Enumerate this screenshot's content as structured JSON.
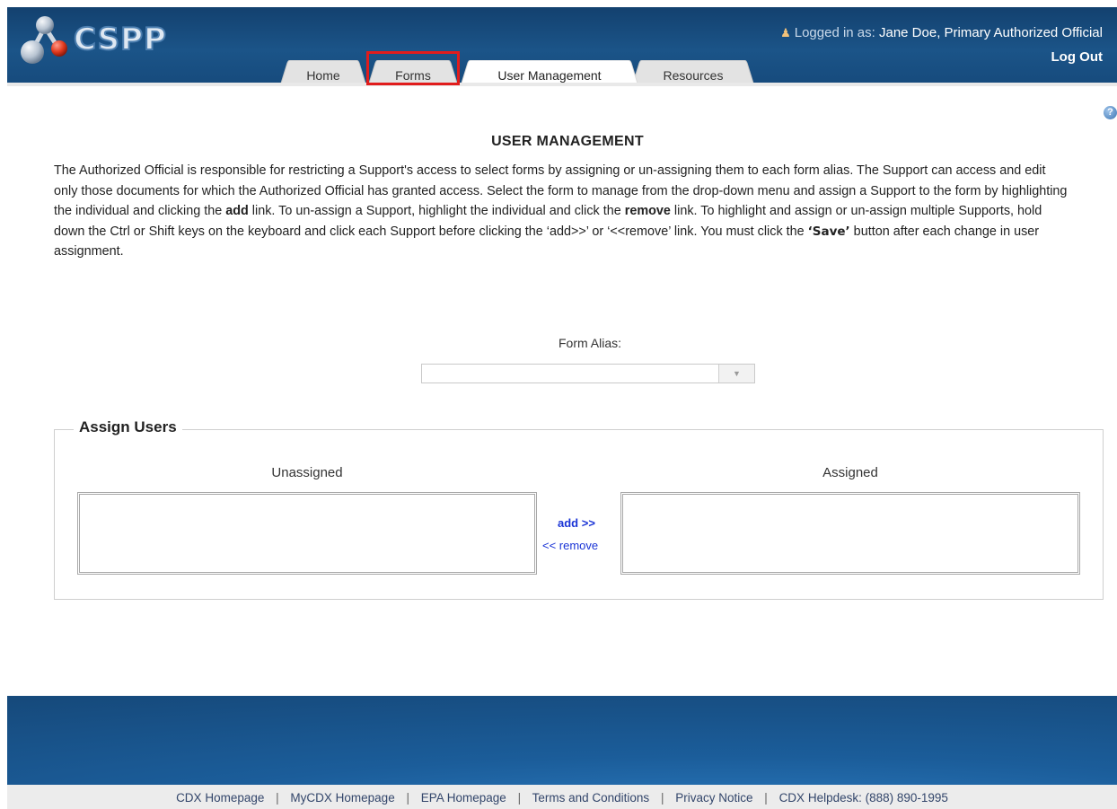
{
  "header": {
    "logo_text": "CSPP",
    "logged_in_prefix": "Logged in as:",
    "user_name": "Jane Doe, Primary Authorized Official",
    "logout_label": "Log Out"
  },
  "tabs": [
    {
      "label": "Home",
      "active": false
    },
    {
      "label": "Forms",
      "active": false,
      "highlighted": true
    },
    {
      "label": "User Management",
      "active": true
    },
    {
      "label": "Resources",
      "active": false
    }
  ],
  "page": {
    "title": "USER MANAGEMENT",
    "description": {
      "part1": "The Authorized Official is responsible for restricting a Support's access to select forms by assigning or un-assigning them to each form alias. The Support can access and edit only those documents for which the Authorized Official has granted access. Select the form to manage from the drop-down menu and assign a Support to the form by highlighting the individual and clicking the ",
      "add_word": "add",
      "part2": " link. To un-assign a Support, highlight the individual and click the ",
      "remove_word": "remove",
      "part3": " link. To highlight and assign or un-assign multiple Supports, hold down the Ctrl or Shift keys on the keyboard and click each Support before clicking the ‘add>>’ or ‘<<remove’ link. You must click the ",
      "save_word": "‘Save’",
      "part4": " button after each change in user assignment."
    },
    "form_alias_label": "Form Alias:",
    "form_alias_value": ""
  },
  "assign_users": {
    "legend": "Assign Users",
    "unassigned_label": "Unassigned",
    "assigned_label": "Assigned",
    "unassigned_items": [],
    "assigned_items": [],
    "add_link": "add >>",
    "remove_link": "<< remove"
  },
  "footer": {
    "links": [
      "CDX Homepage",
      "MyCDX Homepage",
      "EPA Homepage",
      "Terms and Conditions",
      "Privacy Notice",
      "CDX Helpdesk: (888) 890-1995"
    ],
    "separator": "|"
  },
  "colors": {
    "header_blue": "#1b5488",
    "link_blue": "#1a34d6",
    "highlight_red": "#e11c1c"
  }
}
